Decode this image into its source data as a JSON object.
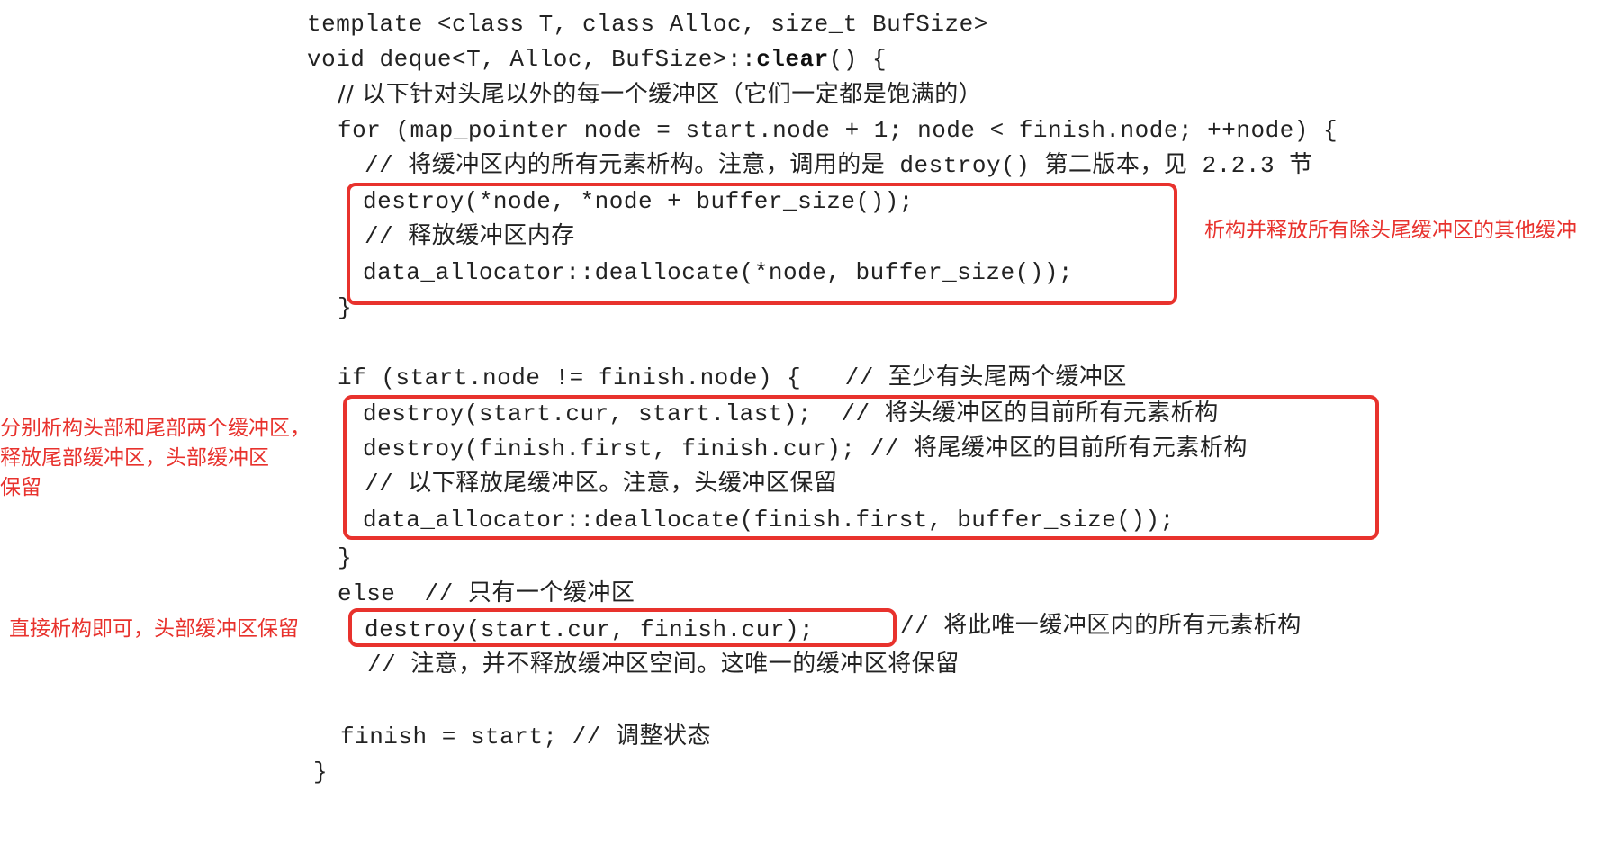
{
  "code": {
    "line_0": "template <class T, class Alloc, size_t BufSize>",
    "line_1_prefix": "void deque<T, Alloc, BufSize>::",
    "line_1_func": "clear",
    "line_1_suffix": "() {",
    "line_2": "// 以下针对头尾以外的每一个缓冲区（它们一定都是饱满的）",
    "line_3": "for (map_pointer node = start.node + 1; node < finish.node; ++node) {",
    "line_4": "// 将缓冲区内的所有元素析构。注意，调用的是 destroy() 第二版本，见 2.2.3 节",
    "line_5": "destroy(*node, *node + buffer_size());",
    "line_6": "// 释放缓冲区内存",
    "line_7": "data_allocator::deallocate(*node, buffer_size());",
    "line_8": "}",
    "line_9": "if (start.node != finish.node) {   // 至少有头尾两个缓冲区",
    "line_10": "destroy(start.cur, start.last);  // 将头缓冲区的目前所有元素析构",
    "line_11": "destroy(finish.first, finish.cur); // 将尾缓冲区的目前所有元素析构",
    "line_12": "// 以下释放尾缓冲区。注意，头缓冲区保留",
    "line_13": "data_allocator::deallocate(finish.first, buffer_size());",
    "line_14": "}",
    "line_15": "else  // 只有一个缓冲区",
    "line_16_code": "destroy(start.cur, finish.cur);",
    "line_16_comment": "// 将此唯一缓冲区内的所有元素析构",
    "line_17": "// 注意，并不释放缓冲区空间。这唯一的缓冲区将保留",
    "line_18": "finish = start; // 调整状态",
    "line_19": "}"
  },
  "annotations": {
    "note_1": "析构并释放所有除头尾缓冲区的其他缓冲",
    "note_2_line1": "分别析构头部和尾部两个缓冲区，",
    "note_2_line2": "释放尾部缓冲区，头部缓冲区",
    "note_2_line3": "保留",
    "note_3": "直接析构即可，头部缓冲区保留"
  },
  "colors": {
    "annotation_red": "#e8322d",
    "code_text": "#222222"
  }
}
